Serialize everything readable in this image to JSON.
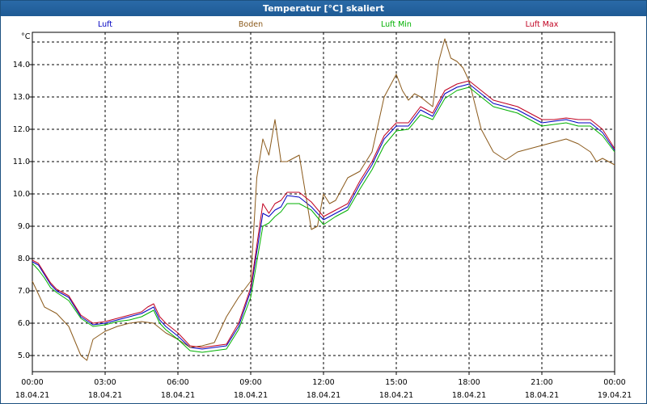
{
  "window": {
    "title": "Temperatur [°C] skaliert"
  },
  "chart_data": {
    "type": "line",
    "title": "Temperatur [°C] skaliert",
    "yunit": "°C",
    "ylim": [
      4.5,
      15.0
    ],
    "yticks": [
      "5.0",
      "6.0",
      "7.0",
      "8.0",
      "9.0",
      "10.0",
      "11.0",
      "12.0",
      "13.0",
      "14.0"
    ],
    "xlim": [
      0,
      24
    ],
    "xticks": [
      {
        "time": "00:00",
        "date": "18.04.21"
      },
      {
        "time": "03:00",
        "date": "18.04.21"
      },
      {
        "time": "06:00",
        "date": "18.04.21"
      },
      {
        "time": "09:00",
        "date": "18.04.21"
      },
      {
        "time": "12:00",
        "date": "18.04.21"
      },
      {
        "time": "15:00",
        "date": "18.04.21"
      },
      {
        "time": "18:00",
        "date": "18.04.21"
      },
      {
        "time": "21:00",
        "date": "18.04.21"
      },
      {
        "time": "00:00",
        "date": "19.04.21"
      }
    ],
    "grid": true,
    "legend_position": "top",
    "series": [
      {
        "name": "Luft",
        "color": "#0000c0",
        "x": [
          0,
          0.25,
          0.5,
          0.75,
          1,
          1.5,
          2,
          2.5,
          3,
          3.5,
          4,
          4.5,
          4.75,
          5,
          5.25,
          5.5,
          6,
          6.5,
          7,
          7.5,
          8,
          8.5,
          9,
          9.25,
          9.5,
          9.75,
          10,
          10.25,
          10.5,
          11,
          11.5,
          12,
          12.5,
          13,
          13.5,
          14,
          14.5,
          15,
          15.5,
          16,
          16.5,
          17,
          17.5,
          18,
          18.5,
          19,
          19.5,
          20,
          20.5,
          21,
          21.5,
          22,
          22.5,
          23,
          23.5,
          24
        ],
        "y": [
          7.9,
          7.8,
          7.5,
          7.2,
          7.0,
          6.8,
          6.2,
          5.95,
          6.0,
          6.1,
          6.2,
          6.3,
          6.4,
          6.5,
          6.1,
          5.9,
          5.6,
          5.25,
          5.2,
          5.25,
          5.3,
          5.9,
          7.0,
          8.2,
          9.4,
          9.3,
          9.5,
          9.6,
          9.95,
          9.9,
          9.6,
          9.2,
          9.4,
          9.6,
          10.3,
          10.9,
          11.7,
          12.1,
          12.1,
          12.6,
          12.4,
          13.1,
          13.3,
          13.4,
          13.1,
          12.8,
          12.7,
          12.6,
          12.4,
          12.2,
          12.25,
          12.3,
          12.2,
          12.2,
          11.9,
          11.35
        ]
      },
      {
        "name": "Boden",
        "color": "#8b5a1b",
        "x": [
          0,
          0.5,
          1,
          1.5,
          2,
          2.25,
          2.5,
          3,
          3.5,
          4,
          4.5,
          5,
          5.5,
          6,
          6.5,
          7,
          7.5,
          8,
          8.5,
          9,
          9.25,
          9.5,
          9.75,
          10,
          10.25,
          10.5,
          11,
          11.5,
          11.75,
          12,
          12.25,
          12.5,
          13,
          13.5,
          14,
          14.5,
          15,
          15.25,
          15.5,
          15.75,
          16,
          16.5,
          16.75,
          17,
          17.25,
          17.5,
          17.75,
          18,
          18.5,
          19,
          19.5,
          20,
          20.5,
          21,
          21.5,
          22,
          22.5,
          23,
          23.25,
          23.5,
          24
        ],
        "y": [
          7.3,
          6.5,
          6.3,
          5.9,
          5.0,
          4.85,
          5.5,
          5.75,
          5.9,
          6.0,
          6.05,
          6.0,
          5.7,
          5.5,
          5.25,
          5.3,
          5.4,
          6.2,
          6.8,
          7.3,
          10.5,
          11.7,
          11.2,
          12.3,
          11.0,
          11.0,
          11.2,
          8.9,
          9.0,
          10.0,
          9.7,
          9.8,
          10.5,
          10.7,
          11.3,
          13.0,
          13.7,
          13.2,
          12.9,
          13.1,
          13.0,
          12.7,
          14.1,
          14.8,
          14.2,
          14.1,
          13.9,
          13.5,
          12.0,
          11.3,
          11.05,
          11.3,
          11.4,
          11.5,
          11.6,
          11.7,
          11.55,
          11.3,
          11.0,
          11.1,
          10.9
        ]
      },
      {
        "name": "Luft Min",
        "color": "#00b000",
        "x": [
          0,
          0.25,
          0.5,
          0.75,
          1,
          1.5,
          2,
          2.5,
          3,
          3.5,
          4,
          4.5,
          4.75,
          5,
          5.25,
          5.5,
          6,
          6.5,
          7,
          7.5,
          8,
          8.5,
          9,
          9.25,
          9.5,
          9.75,
          10,
          10.25,
          10.5,
          11,
          11.5,
          12,
          12.5,
          13,
          13.5,
          14,
          14.5,
          15,
          15.5,
          16,
          16.5,
          17,
          17.5,
          18,
          18.5,
          19,
          19.5,
          20,
          20.5,
          21,
          21.5,
          22,
          22.5,
          23,
          23.5,
          24
        ],
        "y": [
          7.85,
          7.65,
          7.4,
          7.1,
          6.95,
          6.7,
          6.15,
          5.9,
          5.95,
          6.05,
          6.1,
          6.2,
          6.3,
          6.4,
          6.0,
          5.8,
          5.5,
          5.15,
          5.1,
          5.15,
          5.2,
          5.8,
          6.8,
          7.9,
          9.0,
          9.1,
          9.3,
          9.45,
          9.7,
          9.7,
          9.5,
          9.05,
          9.3,
          9.5,
          10.15,
          10.75,
          11.5,
          11.95,
          12.0,
          12.45,
          12.3,
          12.95,
          13.2,
          13.3,
          13.0,
          12.7,
          12.6,
          12.5,
          12.3,
          12.1,
          12.15,
          12.2,
          12.1,
          12.1,
          11.8,
          11.3
        ]
      },
      {
        "name": "Luft Max",
        "color": "#c00020",
        "x": [
          0,
          0.25,
          0.5,
          0.75,
          1,
          1.5,
          2,
          2.5,
          3,
          3.5,
          4,
          4.5,
          4.75,
          5,
          5.25,
          5.5,
          6,
          6.5,
          7,
          7.5,
          8,
          8.5,
          9,
          9.25,
          9.5,
          9.75,
          10,
          10.25,
          10.5,
          11,
          11.5,
          12,
          12.5,
          13,
          13.5,
          14,
          14.5,
          15,
          15.5,
          16,
          16.5,
          17,
          17.5,
          18,
          18.5,
          19,
          19.5,
          20,
          20.5,
          21,
          21.5,
          22,
          22.5,
          23,
          23.5,
          24
        ],
        "y": [
          7.95,
          7.85,
          7.55,
          7.25,
          7.05,
          6.85,
          6.25,
          6.0,
          6.05,
          6.15,
          6.25,
          6.35,
          6.5,
          6.6,
          6.2,
          6.0,
          5.7,
          5.3,
          5.25,
          5.3,
          5.35,
          6.0,
          7.1,
          8.4,
          9.7,
          9.4,
          9.7,
          9.8,
          10.05,
          10.05,
          9.75,
          9.3,
          9.5,
          9.7,
          10.4,
          11.0,
          11.8,
          12.2,
          12.2,
          12.7,
          12.5,
          13.2,
          13.4,
          13.5,
          13.2,
          12.9,
          12.8,
          12.7,
          12.5,
          12.3,
          12.3,
          12.35,
          12.3,
          12.3,
          12.0,
          11.4
        ]
      }
    ]
  }
}
